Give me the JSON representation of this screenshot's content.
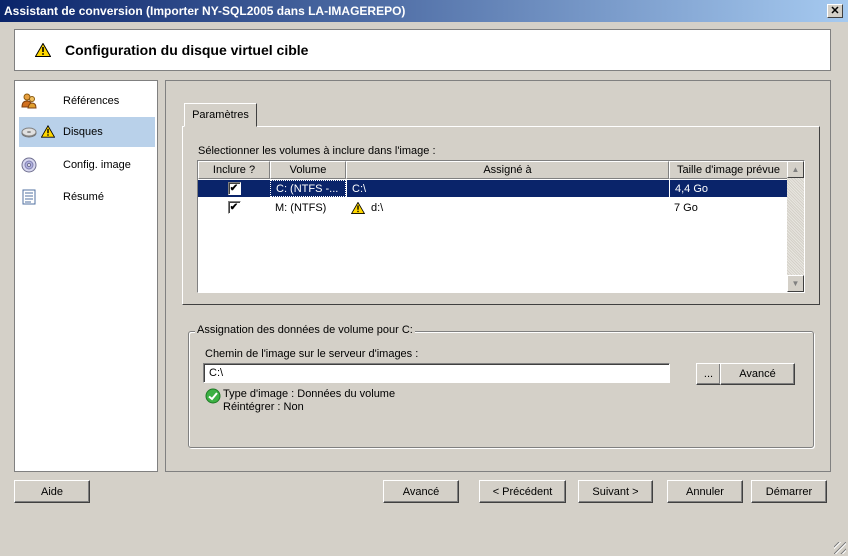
{
  "window": {
    "title": "Assistant de conversion (Importer NY-SQL2005 dans LA-IMAGEREPO)",
    "close_glyph": "✕"
  },
  "header": {
    "title": "Configuration du disque virtuel cible",
    "icon": "warning-icon"
  },
  "nav": {
    "items": [
      {
        "label": "Références",
        "icon": "users-icon"
      },
      {
        "label": "Disques",
        "icon": "disk-icon",
        "selected": true,
        "warning": true
      },
      {
        "label": "Config. image",
        "icon": "cd-icon"
      },
      {
        "label": "Résumé",
        "icon": "document-icon"
      }
    ]
  },
  "tab": {
    "label": "Paramètres"
  },
  "volumes": {
    "select_label": "Sélectionner les volumes à inclure dans l'image :",
    "columns": [
      "Inclure ?",
      "Volume",
      "Assigné à",
      "Taille d'image prévue"
    ],
    "rows": [
      {
        "include": true,
        "volume": "C:  (NTFS  -...",
        "assigned": "C:\\",
        "size": "4,4 Go",
        "warning": false,
        "selected": true
      },
      {
        "include": true,
        "volume": "M:  (NTFS)",
        "assigned": "d:\\",
        "size": "7 Go",
        "warning": true,
        "selected": false
      }
    ],
    "check_glyph": "✔"
  },
  "group": {
    "legend": "Assignation des données de volume pour C:",
    "path_label": "Chemin de l'image sur le serveur d'images :",
    "path_value": "C:\\",
    "browse_label": "...",
    "advanced_label": "Avancé",
    "info_type": "Type d'image : Données du volume",
    "info_reintegrate": "Réintégrer : Non"
  },
  "buttons": {
    "help": {
      "label": "Aide"
    },
    "advanced": {
      "label": "Avancé"
    },
    "previous": {
      "label": "< Précédent"
    },
    "next": {
      "label": "Suivant >"
    },
    "cancel": {
      "label": "Annuler"
    },
    "start": {
      "label": "Démarrer"
    }
  },
  "colors": {
    "title_bar": "#0a246a",
    "selection": "#0a246a",
    "nav_selected": "#b9d1ea",
    "face": "#d4d0c8"
  }
}
